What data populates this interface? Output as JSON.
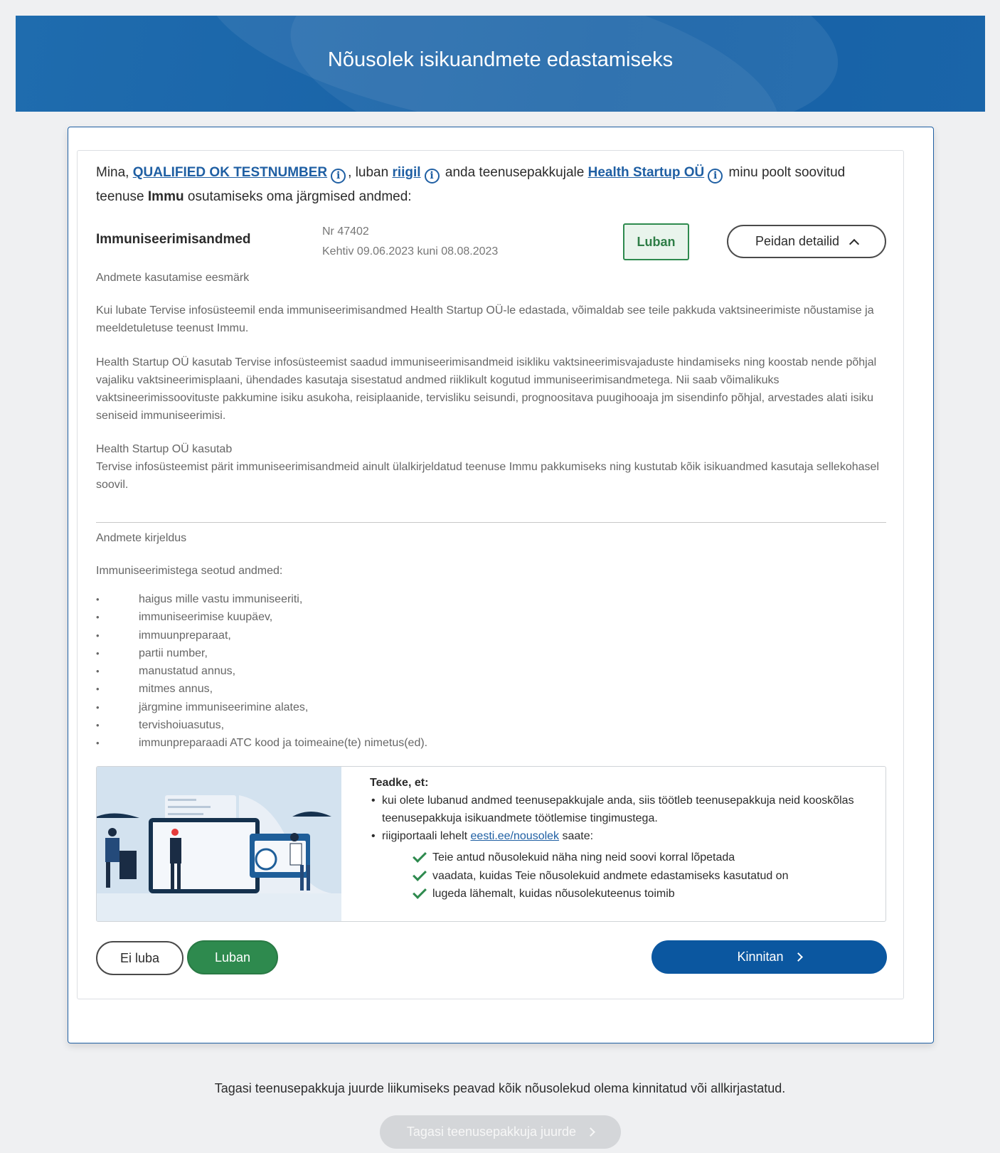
{
  "header": {
    "title": "Nõusolek isikuandmete edastamiseks"
  },
  "intro": {
    "p1": "Mina,",
    "person": "QUALIFIED OK TESTNUMBER",
    "p2": ", luban",
    "state": "riigil",
    "p3": "anda teenusepakkujale",
    "provider": "Health Startup OÜ",
    "p4": "minu poolt soovitud teenuse",
    "service": "Immu",
    "p5": "osutamiseks oma järgmised andmed:"
  },
  "consent_row": {
    "title": "Immuniseerimisandmed",
    "number": "Nr 47402",
    "validity": "Kehtiv 09.06.2023 kuni 08.08.2023",
    "status": "Luban",
    "details_button": "Peidan detailid"
  },
  "purpose": {
    "heading": "Andmete kasutamise eesmärk",
    "para1": "Kui lubate Tervise infosüsteemil enda immuniseerimisandmed Health Startup OÜ-le edastada, võimaldab see teile pakkuda vaktsineerimiste nõustamise ja meeldetuletuse teenust Immu.",
    "para2": "Health Startup OÜ kasutab Tervise infosüsteemist saadud immuniseerimisandmeid isikliku vaktsineerimisvajaduste hindamiseks ning koostab nende põhjal vajaliku vaktsineerimisplaani, ühendades kasutaja sisestatud andmed riiklikult kogutud immuniseerimisandmetega. Nii saab võimalikuks vaktsineerimissoovituste pakkumine isiku asukoha, reisiplaanide, tervisliku seisundi, prognoositava puugihooaja jm sisendinfo põhjal, arvestades alati isiku seniseid immuniseerimisi.",
    "para3_line1": "Health Startup OÜ kasutab",
    "para3_line2": "Tervise infosüsteemist pärit immuniseerimisandmeid ainult ülalkirjeldatud teenuse Immu pakkumiseks ning kustutab kõik isikuandmed kasutaja sellekohasel soovil."
  },
  "description": {
    "heading": "Andmete kirjeldus",
    "intro": "Immuniseerimistega seotud andmed:",
    "items": [
      "haigus mille vastu immuniseeriti,",
      "immuniseerimise kuupäev,",
      "immuunpreparaat,",
      "partii number,",
      "manustatud annus,",
      "mitmes annus,",
      "järgmine immuniseerimine alates,",
      "tervishoiuasutus,",
      "immunpreparaadi ATC kood ja toimeaine(te)  nimetus(ed)."
    ]
  },
  "notice": {
    "heading": "Teadke, et:",
    "bullet1": "kui olete lubanud andmed teenusepakkujale anda, siis töötleb teenusepakkuja neid kooskõlas teenusepakkuja isikuandmete töötlemise tingimustega.",
    "bullet2_pre": "riigiportaali lehelt",
    "bullet2_link": "eesti.ee/nousolek",
    "bullet2_post": "saate:",
    "checks": [
      "Teie antud nõusolekuid näha ning neid soovi korral lõpetada",
      "vaadata, kuidas Teie nõusolekuid andmete edastamiseks kasutatud on",
      "lugeda lähemalt, kuidas nõusolekuteenus toimib"
    ],
    "icons": {
      "check": "check-icon"
    }
  },
  "actions": {
    "decline": "Ei luba",
    "allow": "Luban",
    "confirm": "Kinnitan"
  },
  "footer": {
    "note": "Tagasi teenusepakkuja juurde liikumiseks peavad kõik nõusolekud olema kinnitatud või allkirjastatud.",
    "back_button": "Tagasi teenusepakkuja juurde"
  },
  "colors": {
    "brand_blue": "#0b57a0",
    "banner_blue": "#1a64a8",
    "success_green": "#2e8a4e",
    "disabled_gray": "#d4d6d9"
  }
}
